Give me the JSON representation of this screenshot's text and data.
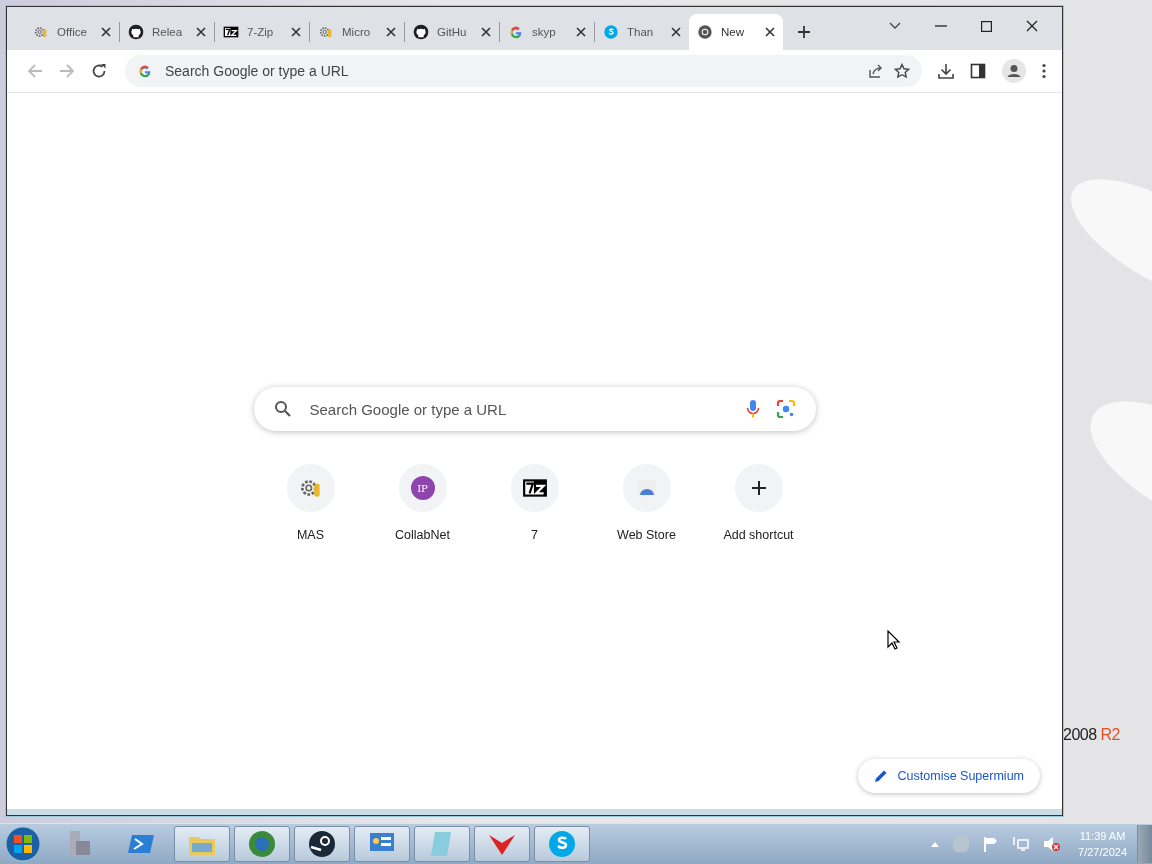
{
  "window": {
    "tabs": [
      {
        "kind": "gear",
        "label": "Office",
        "selected": false
      },
      {
        "kind": "github",
        "label": "Relea",
        "selected": false
      },
      {
        "kind": "sevenzip",
        "label": "7-Zip",
        "selected": false
      },
      {
        "kind": "gear",
        "label": "Micro",
        "selected": false
      },
      {
        "kind": "github",
        "label": "GitHu",
        "selected": false
      },
      {
        "kind": "google",
        "label": "skyp",
        "selected": false
      },
      {
        "kind": "skype",
        "label": "Than",
        "selected": false
      },
      {
        "kind": "chrome",
        "label": "New",
        "selected": true
      }
    ]
  },
  "toolbar": {
    "address_placeholder": "Search Google or type a URL"
  },
  "new_tab_page": {
    "search_placeholder": "Search Google or type a URL",
    "shortcuts": [
      {
        "kind": "gear",
        "label": "MAS"
      },
      {
        "kind": "ip",
        "label": "CollabNet",
        "icon_text": "IP"
      },
      {
        "kind": "sevenzip",
        "label": "7"
      },
      {
        "kind": "store",
        "label": "Web Store"
      },
      {
        "kind": "add",
        "label": "Add shortcut"
      }
    ],
    "customise_button": "Customise Supermium"
  },
  "wallpaper_text": {
    "version": "2008",
    "edition": "R2"
  },
  "taskbar": {
    "time": "11:39 AM",
    "date": "7/27/2024"
  }
}
